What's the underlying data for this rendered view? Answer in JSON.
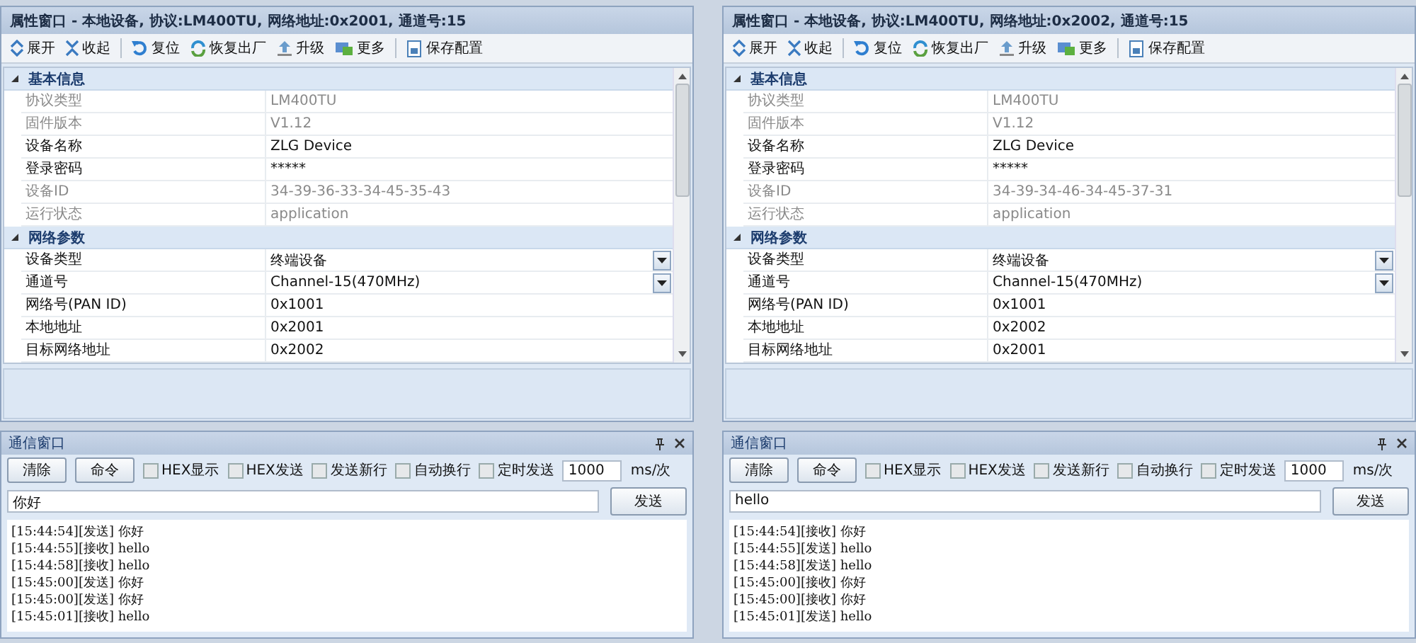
{
  "panes": [
    {
      "property_window": {
        "title": "属性窗口 - 本地设备, 协议:LM400TU, 网络地址:0x2001, 通道号:15",
        "toolbar": [
          [
            {
              "kind": "expand",
              "label": "展开"
            },
            {
              "kind": "collapse",
              "label": "收起"
            }
          ],
          [
            {
              "kind": "reset",
              "label": "复位"
            },
            {
              "kind": "restore",
              "label": "恢复出厂"
            },
            {
              "kind": "upgrade",
              "label": "升级"
            },
            {
              "kind": "more",
              "label": "更多"
            }
          ],
          [
            {
              "kind": "save",
              "label": "保存配置"
            }
          ]
        ],
        "categories": [
          {
            "title": "基本信息",
            "expanded": true,
            "rows": [
              {
                "label": "协议类型",
                "value": "LM400TU",
                "disabled": true,
                "kind": "text"
              },
              {
                "label": "固件版本",
                "value": "V1.12",
                "disabled": true,
                "kind": "text"
              },
              {
                "label": "设备名称",
                "value": "ZLG Device",
                "disabled": false,
                "kind": "text"
              },
              {
                "label": "登录密码",
                "value": "*****",
                "disabled": false,
                "kind": "text"
              },
              {
                "label": "设备ID",
                "value": "34-39-36-33-34-45-35-43",
                "disabled": true,
                "kind": "text"
              },
              {
                "label": "运行状态",
                "value": "application",
                "disabled": true,
                "kind": "text"
              }
            ]
          },
          {
            "title": "网络参数",
            "expanded": true,
            "rows": [
              {
                "label": "设备类型",
                "value": "终端设备",
                "disabled": false,
                "kind": "dropdown"
              },
              {
                "label": "通道号",
                "value": "Channel-15(470MHz)",
                "disabled": false,
                "kind": "dropdown"
              },
              {
                "label": "网络号(PAN ID)",
                "value": "0x1001",
                "disabled": false,
                "kind": "text"
              },
              {
                "label": "本地地址",
                "value": "0x2001",
                "disabled": false,
                "kind": "text"
              },
              {
                "label": "目标网络地址",
                "value": "0x2002",
                "disabled": false,
                "kind": "text"
              }
            ]
          }
        ]
      },
      "comm_window": {
        "title": "通信窗口",
        "buttons": [
          "清除",
          "命令"
        ],
        "options": [
          {
            "label": "HEX显示",
            "checked": false
          },
          {
            "label": "HEX发送",
            "checked": false
          },
          {
            "label": "发送新行",
            "checked": false
          },
          {
            "label": "自动换行",
            "checked": false
          },
          {
            "label": "定时发送",
            "checked": false
          }
        ],
        "interval": "1000",
        "interval_unit": "ms/次",
        "input": "你好",
        "send_button": "发送",
        "log": [
          "[15:44:54][发送] 你好",
          "[15:44:55][接收] hello",
          "[15:44:58][接收] hello",
          "[15:45:00][发送] 你好",
          "[15:45:00][发送] 你好",
          "[15:45:01][接收] hello"
        ]
      }
    },
    {
      "property_window": {
        "title": "属性窗口 - 本地设备, 协议:LM400TU, 网络地址:0x2002, 通道号:15",
        "toolbar": [
          [
            {
              "kind": "expand",
              "label": "展开"
            },
            {
              "kind": "collapse",
              "label": "收起"
            }
          ],
          [
            {
              "kind": "reset",
              "label": "复位"
            },
            {
              "kind": "restore",
              "label": "恢复出厂"
            },
            {
              "kind": "upgrade",
              "label": "升级"
            },
            {
              "kind": "more",
              "label": "更多"
            }
          ],
          [
            {
              "kind": "save",
              "label": "保存配置"
            }
          ]
        ],
        "categories": [
          {
            "title": "基本信息",
            "expanded": true,
            "rows": [
              {
                "label": "协议类型",
                "value": "LM400TU",
                "disabled": true,
                "kind": "text"
              },
              {
                "label": "固件版本",
                "value": "V1.12",
                "disabled": true,
                "kind": "text"
              },
              {
                "label": "设备名称",
                "value": "ZLG Device",
                "disabled": false,
                "kind": "text"
              },
              {
                "label": "登录密码",
                "value": "*****",
                "disabled": false,
                "kind": "text"
              },
              {
                "label": "设备ID",
                "value": "34-39-34-46-34-45-37-31",
                "disabled": true,
                "kind": "text"
              },
              {
                "label": "运行状态",
                "value": "application",
                "disabled": true,
                "kind": "text"
              }
            ]
          },
          {
            "title": "网络参数",
            "expanded": true,
            "rows": [
              {
                "label": "设备类型",
                "value": "终端设备",
                "disabled": false,
                "kind": "dropdown"
              },
              {
                "label": "通道号",
                "value": "Channel-15(470MHz)",
                "disabled": false,
                "kind": "dropdown"
              },
              {
                "label": "网络号(PAN ID)",
                "value": "0x1001",
                "disabled": false,
                "kind": "text"
              },
              {
                "label": "本地地址",
                "value": "0x2002",
                "disabled": false,
                "kind": "text"
              },
              {
                "label": "目标网络地址",
                "value": "0x2001",
                "disabled": false,
                "kind": "text"
              }
            ]
          }
        ]
      },
      "comm_window": {
        "title": "通信窗口",
        "buttons": [
          "清除",
          "命令"
        ],
        "options": [
          {
            "label": "HEX显示",
            "checked": false
          },
          {
            "label": "HEX发送",
            "checked": false
          },
          {
            "label": "发送新行",
            "checked": false
          },
          {
            "label": "自动换行",
            "checked": false
          },
          {
            "label": "定时发送",
            "checked": false
          }
        ],
        "interval": "1000",
        "interval_unit": "ms/次",
        "input": "hello",
        "send_button": "发送",
        "log": [
          "[15:44:54][接收] 你好",
          "[15:44:55][发送] hello",
          "[15:44:58][发送] hello",
          "[15:45:00][接收] 你好",
          "[15:45:00][接收] 你好",
          "[15:45:01][发送] hello"
        ]
      }
    }
  ]
}
